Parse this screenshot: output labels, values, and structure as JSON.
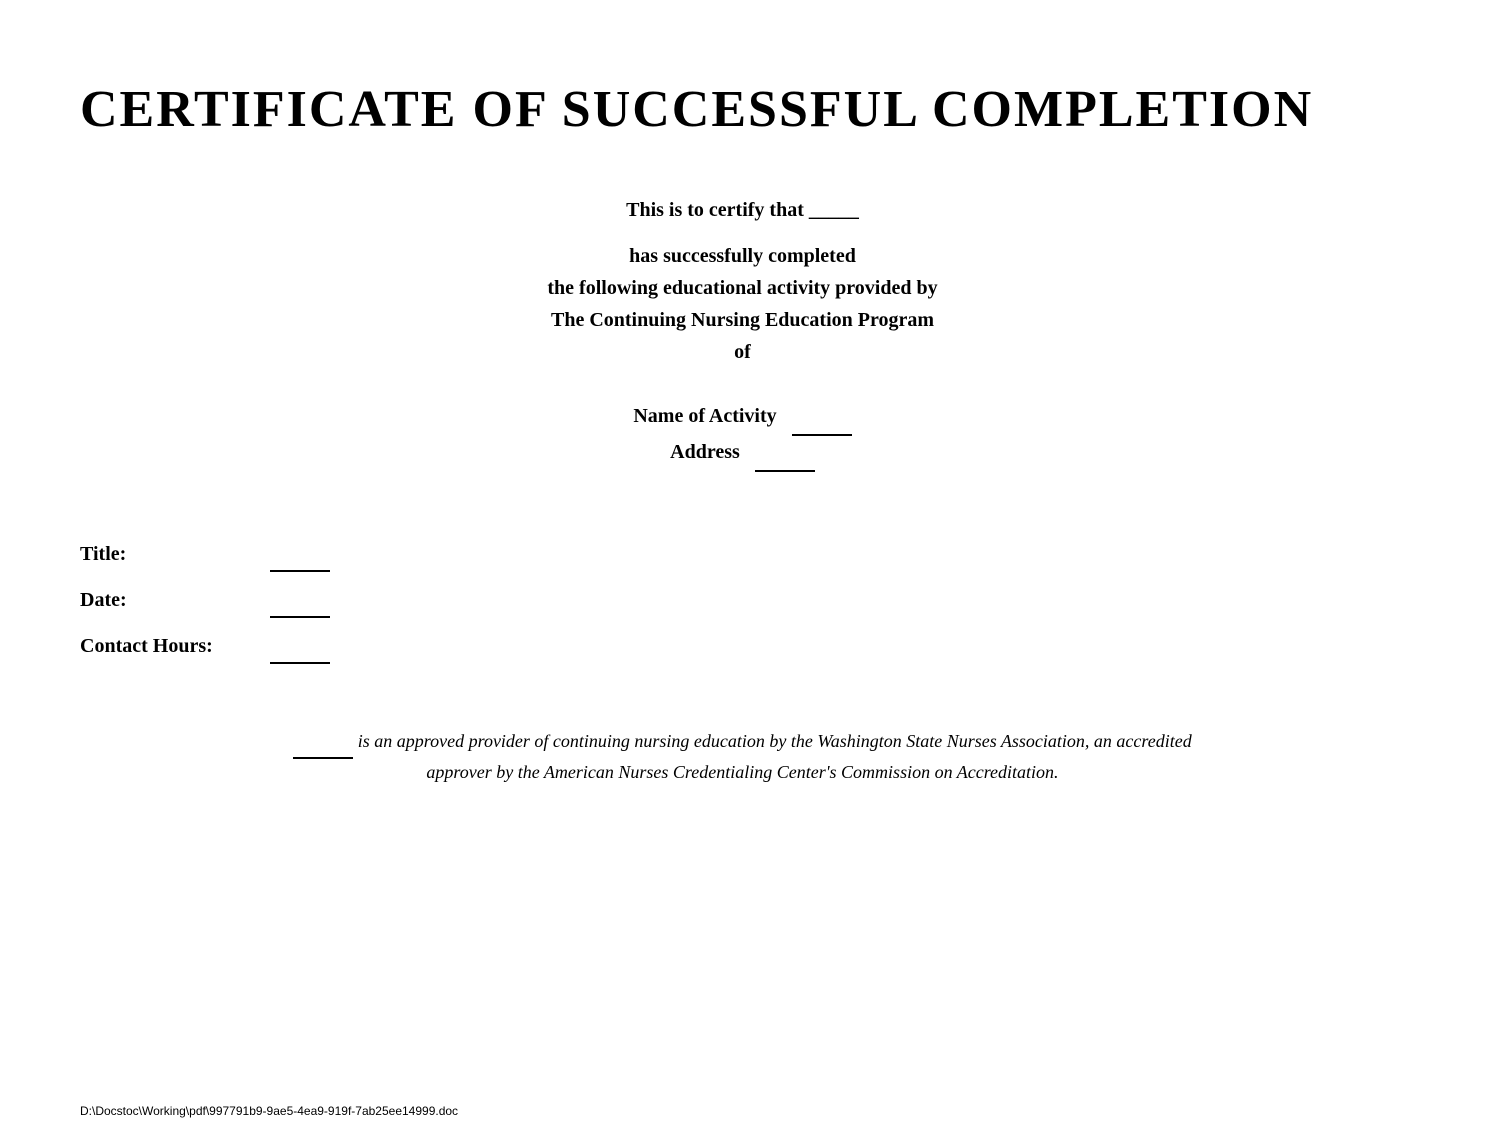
{
  "certificate": {
    "title": "CERTIFICATE  OF  SUCCESSFUL  COMPLETION",
    "intro_text": "This is to certify that _____",
    "body_line1": "has successfully completed",
    "body_line2": "the following educational activity provided by",
    "body_line3": "The Continuing Nursing Education Program",
    "body_line4": "of",
    "activity_label": "Name of Activity",
    "address_label": "Address",
    "blank_activity": "_____",
    "blank_address": "_____",
    "field_title_label": "Title:",
    "field_title_blank": "_____",
    "field_date_label": "Date:",
    "field_date_blank": "_____",
    "field_contact_label": "Contact Hours:",
    "field_contact_blank": "_____",
    "approval_line1_blank": "_____",
    "approval_line1_text": "is an approved provider of continuing nursing education by the Washington State Nurses Association, an accredited",
    "approval_line2_text": "approver by the American Nurses Credentialing Center's Commission on Accreditation.",
    "footer_text": "D:\\Docstoc\\Working\\pdf\\997791b9-9ae5-4ea9-919f-7ab25ee14999.doc"
  }
}
